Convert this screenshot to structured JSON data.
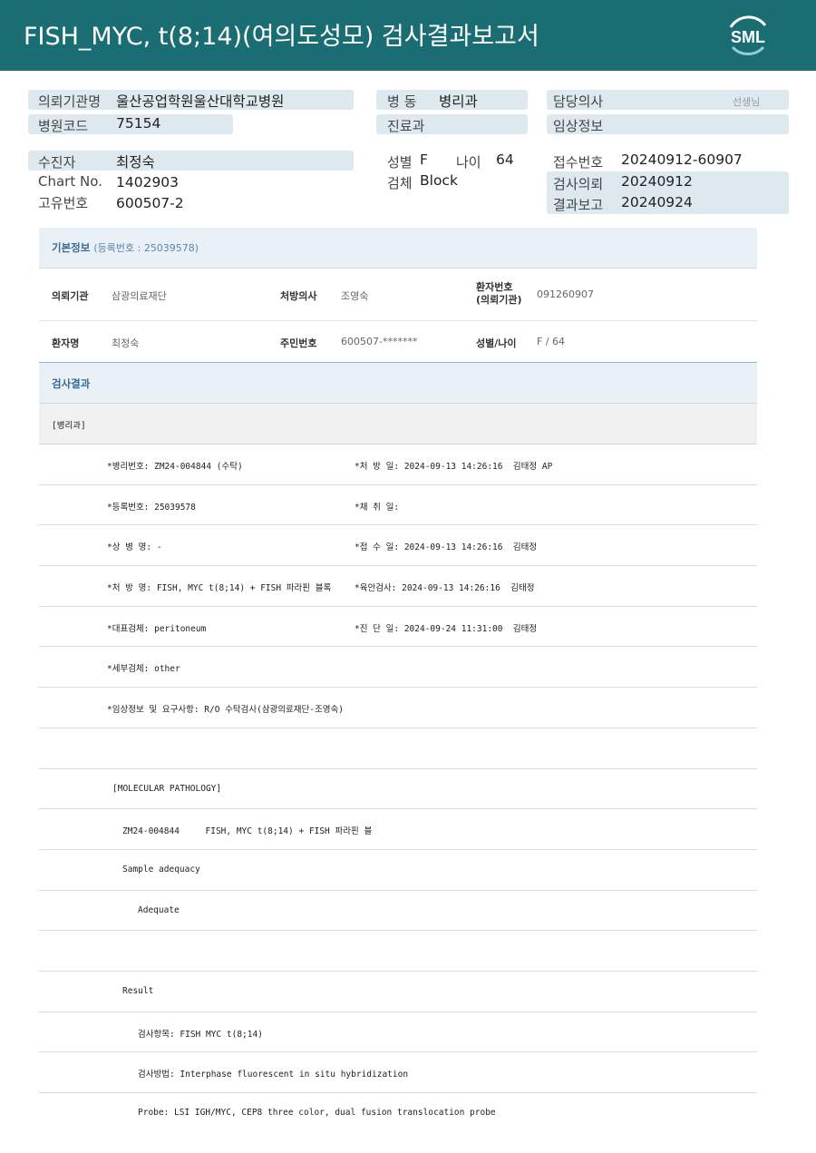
{
  "header": {
    "title": "FISH_MYC,  t(8;14)(여의도성모) 검사결과보고서",
    "logo_text": "SML"
  },
  "top": {
    "institution_label": "의뢰기관명",
    "institution_value": "울산공업학원울산대학교병원",
    "hospital_code_label": "병원코드",
    "hospital_code_value": "75154",
    "ward_label": "병  동",
    "ward_value": "병리과",
    "dept_label": "진료과",
    "doctor_label": "담당의사",
    "doctor_suffix": "선생님",
    "clinical_label": "임상정보",
    "patient_label": "수진자",
    "patient_value": "최정숙",
    "chart_label": "Chart No.",
    "chart_value": "1402903",
    "unique_label": "고유번호",
    "unique_value": "600507-2",
    "sex_label": "성별",
    "sex_value": "F",
    "age_label": "나이",
    "age_value": "64",
    "specimen_label": "검체",
    "specimen_value": "Block",
    "receipt_label": "접수번호",
    "receipt_value": "20240912-60907",
    "request_label": "검사의뢰",
    "request_value": "20240912",
    "report_label": "결과보고",
    "report_value": "20240924"
  },
  "basic": {
    "title": "기본정보",
    "reg_no": "(등록번호 : 25039578)",
    "institution_key": "의뢰기관",
    "institution_val": "삼광의료재단",
    "doctor_key": "처방의사",
    "doctor_val": "조영숙",
    "patient_no_key_1": "환자번호",
    "patient_no_key_2": "(의뢰기관)",
    "patient_no_val": "091260907",
    "name_key": "환자명",
    "name_val": "최정숙",
    "rrn_key": "주민번호",
    "rrn_val": "600507-*******",
    "sexage_key": "성별/나이",
    "sexage_val": "F / 64"
  },
  "result": {
    "title": "검사결과",
    "dept": "[병리과]",
    "lines": [
      {
        "left": "*병리번호: ZM24-004844 (수탁)",
        "right": "*처 방 일: 2024-09-13 14:26:16  김태정 AP"
      },
      {
        "left": "*등록번호: 25039578",
        "right": "*채 취 일:"
      },
      {
        "left": "*상 병 명: -",
        "right": "*접 수 일: 2024-09-13 14:26:16  김태정"
      },
      {
        "left": "*처 방 명: FISH, MYC t(8;14) + FISH 파라핀 블록",
        "right": "*육안검사: 2024-09-13 14:26:16  김태정"
      },
      {
        "left": "*대표검체: peritoneum",
        "right": "*진 단 일: 2024-09-24 11:31:00  김태정"
      },
      {
        "left": "*세부검체: other",
        "right": ""
      },
      {
        "left": "*임상정보 및 요구사항: R/O 수탁검사(삼광의료재단-조영숙)",
        "right": ""
      }
    ],
    "mol_title": "[MOLECULAR PATHOLOGY]",
    "mol_line": "ZM24-004844     FISH, MYC t(8;14) + FISH 파라핀 블",
    "adequacy_label": "Sample adequacy",
    "adequacy_value": "Adequate",
    "result_label": "Result",
    "item_line": "검사항목: FISH MYC t(8;14)",
    "method_line": "검사방법: Interphase fluorescent in situ hybridization",
    "probe_line": "Probe: LSI IGH/MYC, CEP8 three color, dual fusion translocation probe"
  },
  "colors": {
    "header_bg": "#1b6d74",
    "box_bg": "#dde9ee",
    "section_title": "#3d6b93"
  }
}
